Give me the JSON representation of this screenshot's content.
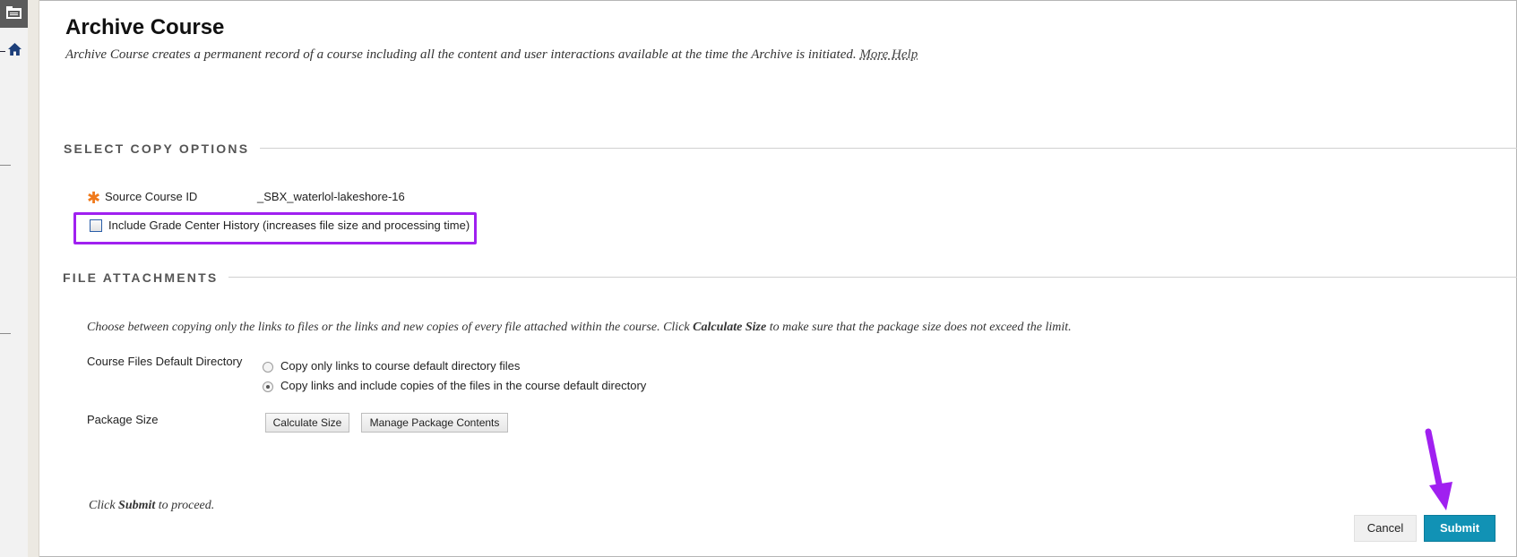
{
  "page": {
    "title": "Archive Course",
    "description": "Archive Course creates a permanent record of a course including all the content and user interactions available at the time the Archive is initiated.",
    "more_help": "More Help"
  },
  "rail": {
    "icons": [
      "folder-icon",
      "home-icon"
    ]
  },
  "copy_options": {
    "heading": "SELECT COPY OPTIONS",
    "source_course_id_label": "Source Course ID",
    "source_course_id_value": "_SBX_waterlol-lakeshore-16",
    "required_marker": "✱",
    "include_grade_center_label": "Include Grade Center History (increases file size and processing time)",
    "include_grade_center_checked": false
  },
  "file_attachments": {
    "heading": "FILE ATTACHMENTS",
    "instructions_pre": "Choose between copying only the links to files or the links and new copies of every file attached within the course. Click ",
    "instructions_bold": "Calculate Size",
    "instructions_post": " to make sure that the package size does not exceed the limit.",
    "default_dir_label": "Course Files Default Directory",
    "options": [
      {
        "label": "Copy only links to course default directory files",
        "selected": false
      },
      {
        "label": "Copy links and include copies of the files in the course default directory",
        "selected": true
      }
    ],
    "package_size_label": "Package Size",
    "calculate_size_button": "Calculate Size",
    "manage_contents_button": "Manage Package Contents"
  },
  "footer": {
    "proceed_pre": "Click ",
    "proceed_bold": "Submit",
    "proceed_post": " to proceed.",
    "cancel_button": "Cancel",
    "submit_button": "Submit"
  },
  "colors": {
    "accent_highlight": "#a020f0",
    "submit_bg": "#1192b5",
    "required_star": "#f07a1c"
  }
}
